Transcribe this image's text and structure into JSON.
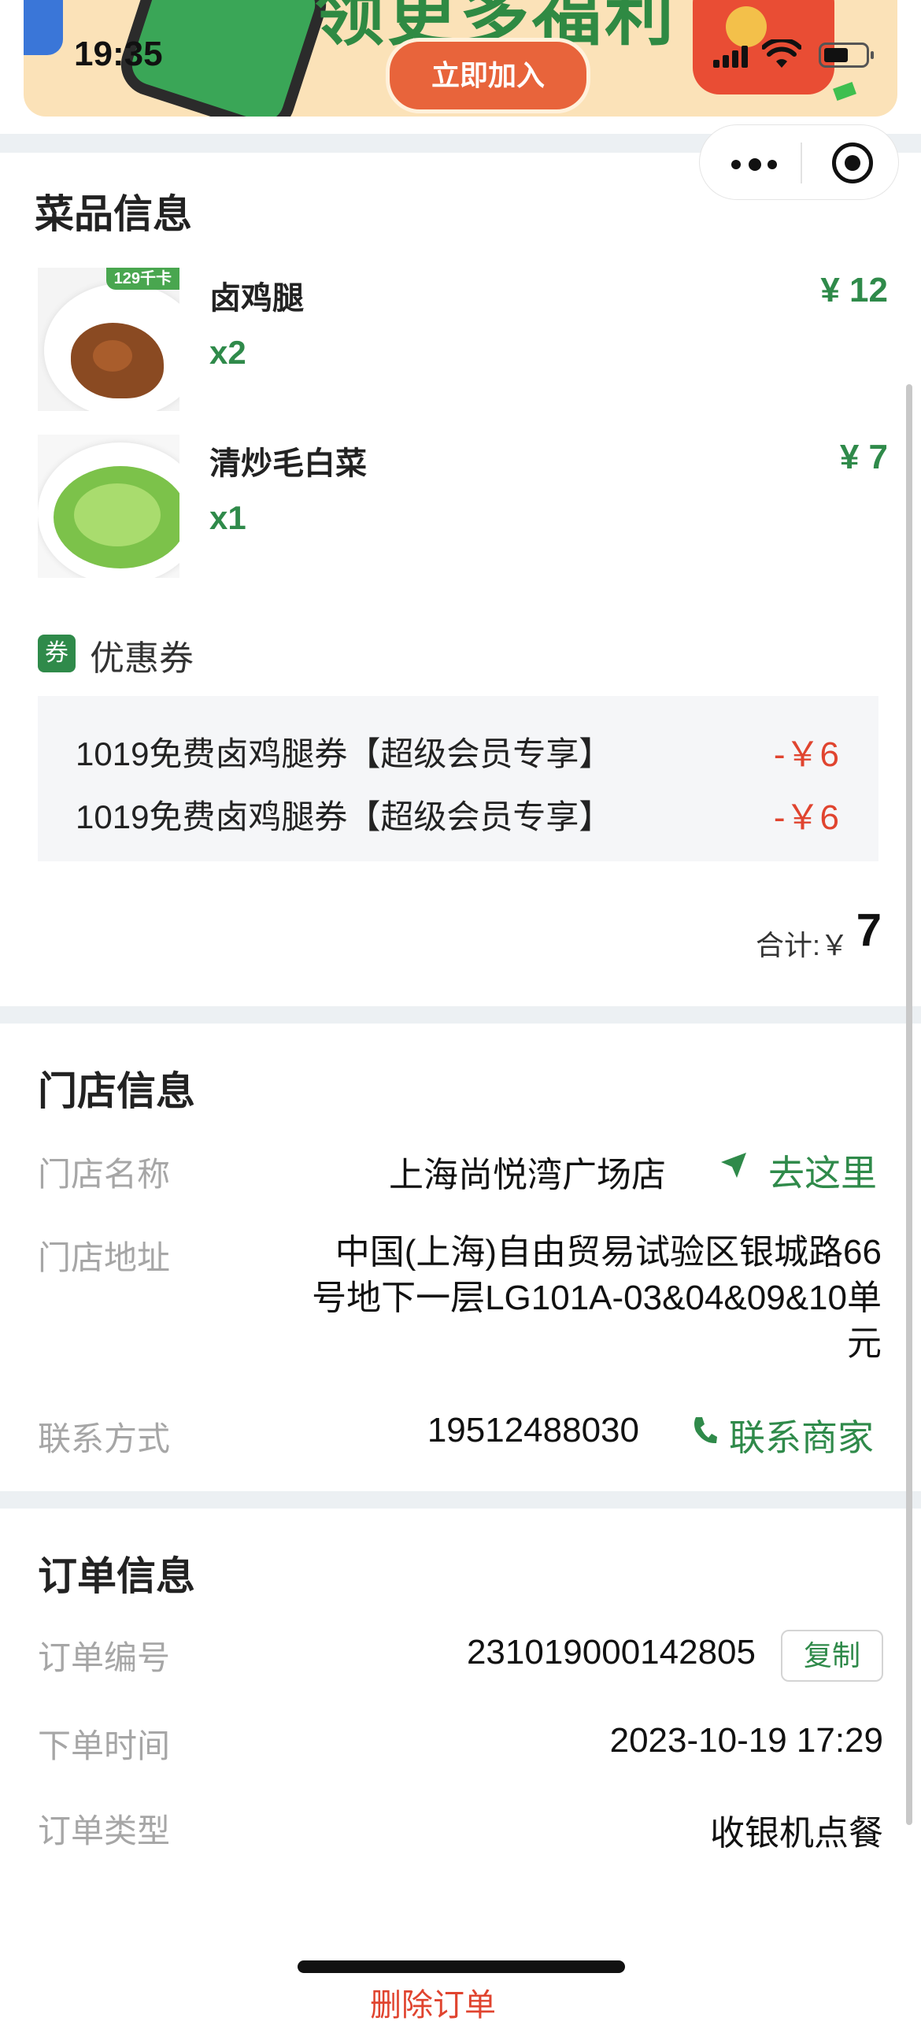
{
  "status_bar": {
    "time": "19:35"
  },
  "banner": {
    "headline": "领更多福利",
    "join_label": "立即加入"
  },
  "dishes_section": {
    "title": "菜品信息",
    "items": [
      {
        "name": "卤鸡腿",
        "qty": "x2",
        "price": "¥ 12",
        "tag": "129千卡",
        "image": "braised-chicken-leg-photo"
      },
      {
        "name": "清炒毛白菜",
        "qty": "x1",
        "price": "¥ 7",
        "image": "stir-fried-greens-photo"
      }
    ]
  },
  "coupons": {
    "icon_text": "券",
    "title": "优惠券",
    "items": [
      {
        "name": "1019免费卤鸡腿券【超级会员专享】",
        "amount": "-￥6"
      },
      {
        "name": "1019免费卤鸡腿券【超级会员专享】",
        "amount": "-￥6"
      }
    ]
  },
  "total": {
    "label": "合计:￥",
    "value": "7"
  },
  "store": {
    "title": "门店信息",
    "name_label": "门店名称",
    "name": "上海尚悦湾广场店",
    "navigate_label": "去这里",
    "address_label": "门店地址",
    "address_line1": "中国(上海)自由贸易试验区银城路66",
    "address_line2": "号地下一层LG101A-03&04&09&10单",
    "address_line3": "元",
    "contact_label": "联系方式",
    "phone": "19512488030",
    "contact_action": "联系商家"
  },
  "order": {
    "title": "订单信息",
    "number_label": "订单编号",
    "number": "231019000142805",
    "copy_label": "复制",
    "time_label": "下单时间",
    "time": "2023-10-19 17:29",
    "type_label": "订单类型",
    "type": "收银机点餐"
  },
  "bottom_peek": "删除订单",
  "colors": {
    "accent_green": "#2f8a4a",
    "discount_red": "#e0442f",
    "divider": "#ecf0f3"
  }
}
